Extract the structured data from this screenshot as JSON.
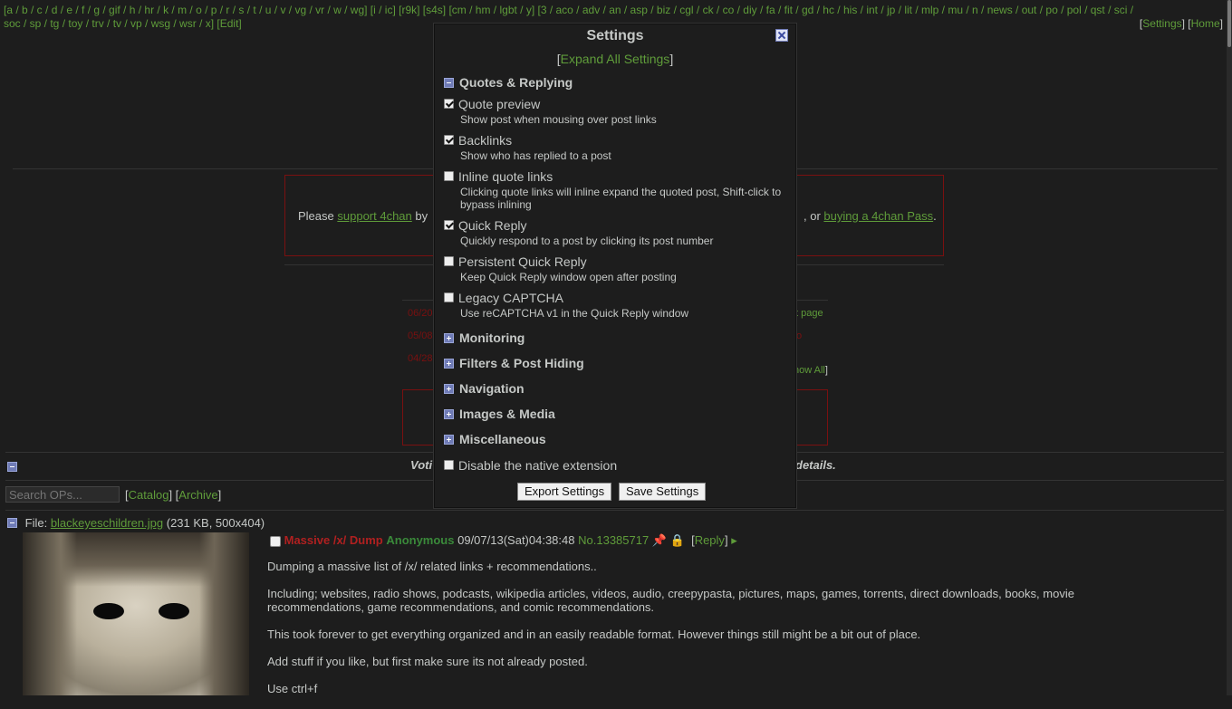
{
  "nav": {
    "line1": "[a / b / c / d / e / f / g / gif / h / hr / k / m / o / p / r / s / t / u / v / vg / vr / w / wg] [i / ic] [r9k] [s4s] [cm / hm / lgbt / y] [3 / aco / adv / an / asp / biz / cgl / ck / co / diy / fa / fit / gd / hc / his / int / jp / lit / mlp / mu / n / news / out / po / pol / qst / sci /",
    "line2": "soc / sp / tg / toy / trv / tv / vp / wsg / wsr / x] [Edit]",
    "settings": "Settings",
    "home": "Home"
  },
  "ad": {
    "prefix": "Please",
    "support_link": "support 4chan",
    "by": "by",
    "or": ", or",
    "pass_link": "buying a 4chan Pass",
    "dot": "."
  },
  "news": {
    "d1": "06/20",
    "d2": "05/08",
    "d3": "04/28",
    "page_link": "t page",
    "show_all": "how All",
    "mark": "o"
  },
  "vote": {
    "left": "Voti",
    "right": "details."
  },
  "board": {
    "search_placeholder": "Search OPs...",
    "catalog": "Catalog",
    "archive": "Archive"
  },
  "op": {
    "file_label": "File:",
    "file_name": "blackeyeschildren.jpg",
    "file_info": "(231 KB, 500x404)",
    "subject": "Massive /x/ Dump",
    "name": "Anonymous",
    "datetime": "09/07/13(Sat)04:38:48",
    "no_label": "No.",
    "post_no": "13385717",
    "reply": "Reply",
    "body": [
      "Dumping a massive list of /x/ related links + recommendations..",
      "Including; websites, radio shows, podcasts, wikipedia articles, videos, audio, creepypasta, pictures, maps, games, torrents, direct downloads, books, movie recommendations, game recommendations, and comic recommendations.",
      "This took forever to get everything organized and in an easily readable format. However things still might be a bit out of place.",
      "Add stuff if you like, but first make sure its not already posted.",
      "Use ctrl+f"
    ]
  },
  "settings": {
    "title": "Settings",
    "expand_all": "Expand All Settings",
    "sections": {
      "quotes": "Quotes & Replying",
      "monitoring": "Monitoring",
      "filters": "Filters & Post Hiding",
      "navigation": "Navigation",
      "images": "Images & Media",
      "misc": "Miscellaneous"
    },
    "options": [
      {
        "label": "Quote preview",
        "desc": "Show post when mousing over post links",
        "checked": true
      },
      {
        "label": "Backlinks",
        "desc": "Show who has replied to a post",
        "checked": true
      },
      {
        "label": "Inline quote links",
        "desc": "Clicking quote links will inline expand the quoted post, Shift-click to bypass inlining",
        "checked": false
      },
      {
        "label": "Quick Reply",
        "desc": "Quickly respond to a post by clicking its post number",
        "checked": true
      },
      {
        "label": "Persistent Quick Reply",
        "desc": "Keep Quick Reply window open after posting",
        "checked": false
      },
      {
        "label": "Legacy CAPTCHA",
        "desc": "Use reCAPTCHA v1 in the Quick Reply window",
        "checked": false
      }
    ],
    "disable_native": "Disable the native extension",
    "export_btn": "Export Settings",
    "save_btn": "Save Settings"
  }
}
